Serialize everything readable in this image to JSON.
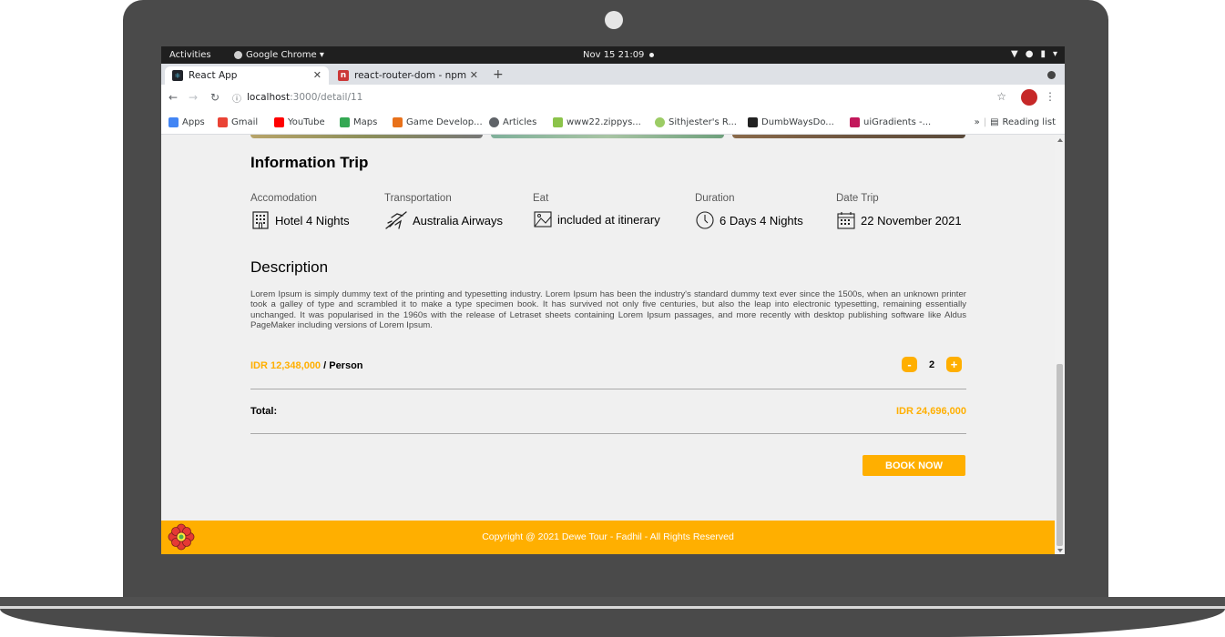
{
  "os_bar": {
    "activities": "Activities",
    "app_menu": "Google Chrome ▾",
    "clock": "Nov 15  21:09"
  },
  "browser": {
    "tabs": [
      {
        "label": "React App",
        "icon": "react-favicon"
      },
      {
        "label": "react-router-dom - npm",
        "icon": "npm-favicon"
      }
    ],
    "new_tab": "+",
    "url_host": "localhost",
    "url_path": ":3000/detail/11",
    "bookmarks": [
      {
        "label": "Apps",
        "icon": "apps-grid-icon",
        "color": "#4285f4"
      },
      {
        "label": "Gmail",
        "icon": "gmail-icon",
        "color": "#ea4335"
      },
      {
        "label": "YouTube",
        "icon": "youtube-icon",
        "color": "#ff0000"
      },
      {
        "label": "Maps",
        "icon": "maps-icon",
        "color": "#34a853"
      },
      {
        "label": "Game Develop...",
        "icon": "gamedev-icon",
        "color": "#e8711a"
      },
      {
        "label": "Articles",
        "icon": "globe-icon",
        "color": "#5f6368"
      },
      {
        "label": "www22.zippys...",
        "icon": "zippyshare-icon",
        "color": "#8bc34a"
      },
      {
        "label": "Sithjester's R...",
        "icon": "sithjester-icon",
        "color": "#9ccc65"
      },
      {
        "label": "DumbWaysDo...",
        "icon": "dumbways-icon",
        "color": "#222222"
      },
      {
        "label": "uiGradients -...",
        "icon": "uigradients-icon",
        "color": "#c2185b"
      }
    ],
    "overflow": "»",
    "reading_list": "Reading list"
  },
  "page": {
    "info_title": "Information Trip",
    "info": [
      {
        "label": "Accomodation",
        "value": "Hotel 4 Nights",
        "icon": "hotel-icon"
      },
      {
        "label": "Transportation",
        "value": "Australia Airways",
        "icon": "airplane-icon"
      },
      {
        "label": "Eat",
        "value": "included at itinerary",
        "icon": "meal-icon"
      },
      {
        "label": "Duration",
        "value": "6 Days 4 Nights",
        "icon": "clock-icon"
      },
      {
        "label": "Date Trip",
        "value": "22 November 2021",
        "icon": "calendar-icon"
      }
    ],
    "description_title": "Description",
    "description": "Lorem Ipsum is simply dummy text of the printing and typesetting industry. Lorem Ipsum has been the industry's standard dummy text ever since the 1500s, when an unknown printer took a galley of type and scrambled it to make a type specimen book. It has survived not only five centuries, but also the leap into electronic typesetting, remaining essentially unchanged. It was popularised in the 1960s with the release of Letraset sheets containing Lorem Ipsum passages, and more recently with desktop publishing software like Aldus PageMaker including versions of Lorem Ipsum.",
    "price_amount": "IDR 12,348,000",
    "price_unit": " / Person",
    "quantity": "2",
    "minus": "-",
    "plus": "+",
    "total_label": "Total:",
    "total_value": "IDR 24,696,000",
    "book_button": "BOOK NOW",
    "footer": "Copyright @ 2021 Dewe Tour - Fadhil - All Rights Reserved"
  },
  "colors": {
    "accent": "#ffaf00"
  }
}
